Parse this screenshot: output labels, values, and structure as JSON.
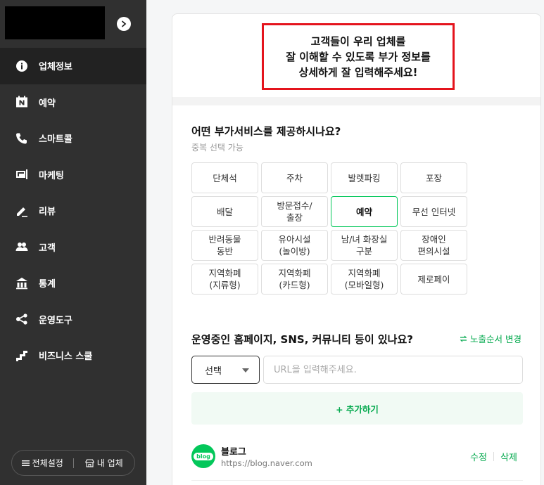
{
  "sidebar": {
    "items": [
      {
        "label": "업체정보",
        "icon": "info-icon",
        "active": true
      },
      {
        "label": "예약",
        "icon": "naver-calendar-icon"
      },
      {
        "label": "스마트콜",
        "icon": "phone-icon"
      },
      {
        "label": "마케팅",
        "icon": "marketing-icon"
      },
      {
        "label": "리뷰",
        "icon": "pencil-icon"
      },
      {
        "label": "고객",
        "icon": "people-icon"
      },
      {
        "label": "통계",
        "icon": "stats-icon"
      },
      {
        "label": "운영도구",
        "icon": "share-icon"
      },
      {
        "label": "비즈니스 스쿨",
        "icon": "stairs-icon"
      }
    ],
    "footer": {
      "settings_label": "전체설정",
      "my_business_label": "내 업체"
    }
  },
  "notice": {
    "text": "고객들이 우리 업체를\n잘 이해할 수 있도록 부가 정보를\n상세하게 잘 입력해주세요!"
  },
  "services": {
    "title": "어떤 부가서비스를 제공하시나요?",
    "subtitle": "중복 선택 가능",
    "options": [
      {
        "label": "단체석"
      },
      {
        "label": "주차"
      },
      {
        "label": "발렛파킹"
      },
      {
        "label": "포장"
      },
      {
        "label": "배달"
      },
      {
        "label": "방문접수/\n출장"
      },
      {
        "label": "예약",
        "selected": true
      },
      {
        "label": "무선 인터넷"
      },
      {
        "label": "반려동물\n동반"
      },
      {
        "label": "유아시설\n(놀이방)"
      },
      {
        "label": "남/녀 화장실\n구분"
      },
      {
        "label": "장애인\n편의시설"
      },
      {
        "label": "지역화폐\n(지류형)"
      },
      {
        "label": "지역화폐\n(카드형)"
      },
      {
        "label": "지역화폐\n(모바일형)"
      },
      {
        "label": "제로페이"
      }
    ]
  },
  "homepage": {
    "title": "운영중인 홈페이지, SNS, 커뮤니티 등이 있나요?",
    "order_link": "노출순서 변경",
    "select_value": "선택",
    "url_placeholder": "URL을 입력해주세요.",
    "add_button": "+ 추가하기",
    "entries": [
      {
        "name": "블로그",
        "url": "https://blog.naver.com",
        "logo_text": "blog",
        "edit": "수정",
        "delete": "삭제"
      }
    ]
  },
  "colors": {
    "accent": "#03c75a",
    "accent_text": "#03a94d",
    "notice_border": "#e4141d",
    "sidebar_bg": "#303030"
  }
}
